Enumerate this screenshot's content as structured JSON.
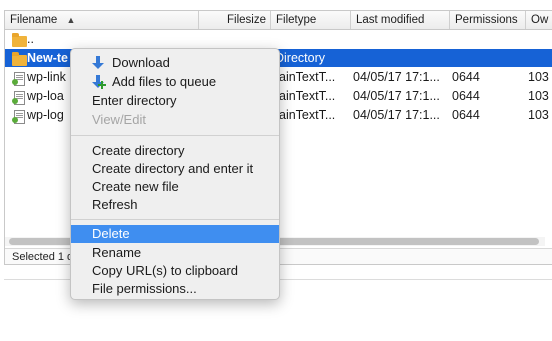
{
  "columns": {
    "filename": "Filename",
    "filesize": "Filesize",
    "filetype": "Filetype",
    "last_modified": "Last modified",
    "permissions": "Permissions",
    "owner": "Ow"
  },
  "rows": [
    {
      "name": "..",
      "icon": "folder-icon",
      "size": "",
      "type": "",
      "modified": "",
      "perms": "",
      "owner": ""
    },
    {
      "name": "New-te",
      "icon": "folder-icon",
      "size": "",
      "type": "Directory",
      "modified": "",
      "perms": "",
      "owner": ""
    },
    {
      "name": "wp-link",
      "icon": "php-file-icon",
      "size": "",
      "type": "ainTextT...",
      "modified": "04/05/17 17:1...",
      "perms": "0644",
      "owner": "103"
    },
    {
      "name": "wp-loa",
      "icon": "php-file-icon",
      "size": "",
      "type": "ainTextT...",
      "modified": "04/05/17 17:1...",
      "perms": "0644",
      "owner": "103"
    },
    {
      "name": "wp-log",
      "icon": "php-file-icon",
      "size": "",
      "type": "ainTextT...",
      "modified": "04/05/17 17:1...",
      "perms": "0644",
      "owner": "103"
    }
  ],
  "status_text": "Selected 1 d",
  "menu": {
    "download": "Download",
    "add_to_queue": "Add files to queue",
    "enter_directory": "Enter directory",
    "view_edit": "View/Edit",
    "create_directory": "Create directory",
    "create_directory_enter": "Create directory and enter it",
    "create_file": "Create new file",
    "refresh": "Refresh",
    "delete": "Delete",
    "rename": "Rename",
    "copy_url": "Copy URL(s) to clipboard",
    "file_permissions": "File permissions..."
  },
  "colors": {
    "selection": "#1662d6",
    "menu_highlight": "#3f8ef0",
    "folder": "#f0b33b",
    "download_arrow": "#3579d6",
    "queue_plus": "#2e9b2e"
  }
}
